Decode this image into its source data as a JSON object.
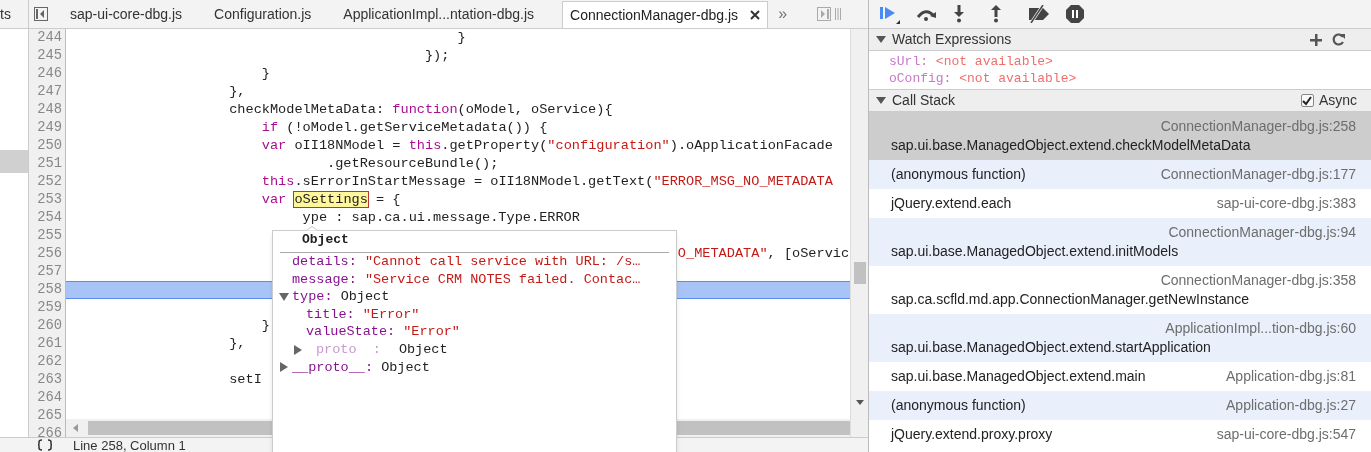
{
  "navigator": {
    "tab_label": "ts"
  },
  "tabs": [
    {
      "label": "sap-ui-core-dbg.js",
      "selected": false
    },
    {
      "label": "Configuration.js",
      "selected": false
    },
    {
      "label": "ApplicationImpl...ntation-dbg.js",
      "selected": false
    },
    {
      "label": "ConnectionManager-dbg.js",
      "selected": true
    }
  ],
  "overflow_label": "»",
  "editor": {
    "lines": [
      {
        "number": "244",
        "selected": false,
        "segments": [
          {
            "text": "                                                }",
            "kind": "plain"
          }
        ]
      },
      {
        "number": "245",
        "selected": false,
        "segments": [
          {
            "text": "                                            });",
            "kind": "plain"
          }
        ]
      },
      {
        "number": "246",
        "selected": false,
        "segments": [
          {
            "text": "                        }",
            "kind": "plain"
          }
        ]
      },
      {
        "number": "247",
        "selected": false,
        "segments": [
          {
            "text": "                    },",
            "kind": "plain"
          }
        ]
      },
      {
        "number": "248",
        "selected": false,
        "segments": [
          {
            "text": "                    checkModelMetaData: ",
            "kind": "plain"
          },
          {
            "text": "function",
            "kind": "keyword"
          },
          {
            "text": "(oModel, oService){",
            "kind": "plain"
          }
        ]
      },
      {
        "number": "249",
        "selected": false,
        "segments": [
          {
            "text": "                        if",
            "kind": "keyword"
          },
          {
            "text": " (!oModel.getServiceMetadata()) {",
            "kind": "plain"
          }
        ]
      },
      {
        "number": "250",
        "selected": false,
        "segments": [
          {
            "text": "                        var",
            "kind": "keyword"
          },
          {
            "text": " oII18NModel = ",
            "kind": "plain"
          },
          {
            "text": "this",
            "kind": "keyword"
          },
          {
            "text": ".getProperty(",
            "kind": "plain"
          },
          {
            "text": "\"configuration\"",
            "kind": "string"
          },
          {
            "text": ").oApplicationFacade",
            "kind": "plain"
          }
        ]
      },
      {
        "number": "251",
        "selected": false,
        "segments": [
          {
            "text": "                                .getResourceBundle();",
            "kind": "plain"
          }
        ]
      },
      {
        "number": "252",
        "selected": false,
        "segments": [
          {
            "text": "                        this",
            "kind": "keyword"
          },
          {
            "text": ".sErrorInStartMessage = oII18NModel.getText(",
            "kind": "plain"
          },
          {
            "text": "\"ERROR_MSG_NO_METADATA",
            "kind": "string"
          }
        ]
      },
      {
        "number": "253",
        "selected": false,
        "segments": [
          {
            "text": "                        var ",
            "kind": "keyword"
          },
          {
            "text": "oSettings",
            "kind": "highlight"
          },
          {
            "text": " = {",
            "kind": "plain"
          }
        ]
      },
      {
        "number": "254",
        "selected": false,
        "segments": [
          {
            "text": "                             ype : sap.ca.ui.message.Type.ERROR",
            "kind": "plain"
          }
        ]
      },
      {
        "number": "255",
        "selected": false
      },
      {
        "number": "256",
        "selected": false,
        "segments": [
          {
            "text": "                                                                           O_METADATA\"",
            "kind": "string"
          },
          {
            "text": ", [oServic",
            "kind": "plain"
          }
        ]
      },
      {
        "number": "257",
        "selected": false
      },
      {
        "number": "258",
        "selected": true
      },
      {
        "number": "259",
        "selected": false
      },
      {
        "number": "260",
        "selected": false,
        "segments": [
          {
            "text": "                        }",
            "kind": "plain"
          }
        ]
      },
      {
        "number": "261",
        "selected": false,
        "segments": [
          {
            "text": "                    },",
            "kind": "plain"
          }
        ]
      },
      {
        "number": "262",
        "selected": false
      },
      {
        "number": "263",
        "selected": false,
        "segments": [
          {
            "text": "                    setI",
            "kind": "plain"
          }
        ]
      },
      {
        "number": "264",
        "selected": false
      },
      {
        "number": "265",
        "selected": false
      },
      {
        "number": "266"
      }
    ]
  },
  "tooltip": {
    "title": "Object",
    "properties": [
      {
        "name": "details:",
        "value": "\"Cannot call service with URL: /s…",
        "kind": "string",
        "dimmed": false
      },
      {
        "name": "message:",
        "value": "\"Service CRM NOTES failed. Contac…",
        "kind": "string",
        "dimmed": false
      },
      {
        "name": "type:",
        "value": "Object",
        "kind": "object",
        "expanded": true,
        "dimmed": false,
        "children": [
          {
            "name": "title:",
            "value": "\"Error\"",
            "kind": "string",
            "dimmed": false
          },
          {
            "name": "valueState:",
            "value": "\"Error\"",
            "kind": "string",
            "dimmed": false
          },
          {
            "name": "proto  :",
            "value": "Object",
            "kind": "object",
            "expanded": false,
            "dimmed": true
          }
        ]
      },
      {
        "name": "__proto__:",
        "value": "Object",
        "kind": "object",
        "expanded": false,
        "dimmed": false
      }
    ]
  },
  "status_bar": {
    "position": "Line 258, Column 1"
  },
  "watch_expressions": {
    "title": "Watch Expressions",
    "items": [
      {
        "name": "sUrl:",
        "value": "<not available>"
      },
      {
        "name": "oConfig:",
        "value": "<not available>"
      }
    ]
  },
  "call_stack": {
    "title": "Call Stack",
    "async_label": "Async",
    "async_checked": true,
    "frames": [
      {
        "function": "sap.ui.base.ManagedObject.extend.checkModelMetaData",
        "location": "ConnectionManager-dbg.js:258",
        "selected": true
      },
      {
        "function": "(anonymous function)",
        "location": "ConnectionManager-dbg.js:177",
        "selected": false
      },
      {
        "function": "jQuery.extend.each",
        "location": "sap-ui-core-dbg.js:383",
        "selected": false
      },
      {
        "function": "sap.ui.base.ManagedObject.extend.initModels",
        "location": "ConnectionManager-dbg.js:94",
        "selected": false
      },
      {
        "function": "sap.ca.scfld.md.app.ConnectionManager.getNewInstance",
        "location": "ConnectionManager-dbg.js:358",
        "selected": false
      },
      {
        "function": "sap.ui.base.ManagedObject.extend.startApplication",
        "location": "ApplicationImpl...tion-dbg.js:60",
        "selected": false
      },
      {
        "function": "sap.ui.base.ManagedObject.extend.main",
        "location": "Application-dbg.js:81",
        "selected": false
      },
      {
        "function": "(anonymous function)",
        "location": "Application-dbg.js:27",
        "selected": false
      },
      {
        "function": "jQuery.extend.proxy.proxy",
        "location": "sap-ui-core-dbg.js:547",
        "selected": false
      }
    ]
  }
}
